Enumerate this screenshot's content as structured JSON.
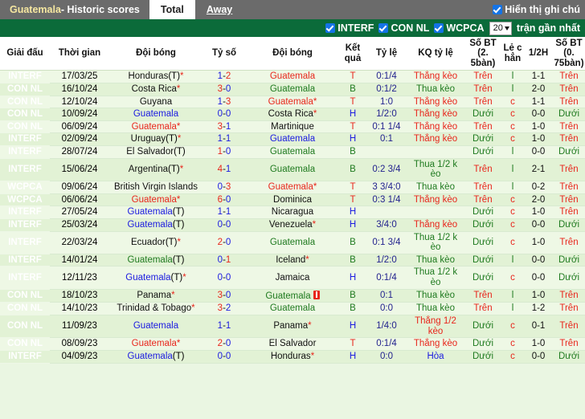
{
  "topbar": {
    "team": "Guatemala",
    "title_rest": " - Historic scores",
    "tab_total": "Total",
    "tab_away": "Away",
    "show_notes_label": "Hiển thị ghi chú",
    "show_notes_checked": true
  },
  "filterbar": {
    "items": [
      {
        "label": "INTERF",
        "checked": true
      },
      {
        "label": "CON NL",
        "checked": true
      },
      {
        "label": "WCPCA",
        "checked": true
      }
    ],
    "count_value": "20",
    "count_suffix": "trận gần nhất"
  },
  "table": {
    "headers": [
      "Giải đấu",
      "Thời gian",
      "Đội bóng",
      "Tỷ số",
      "Đội bóng",
      "Kết quả",
      "Tỷ lệ",
      "KQ tỷ lệ",
      "Số BT (2. 5bàn)",
      "Lẻ c hẳn",
      "1/2H",
      "Số BT (0. 75bàn)"
    ],
    "rows": [
      {
        "league": "INTERF",
        "lg": "INTERF",
        "date": "17/03/25",
        "home": "Honduras(T)",
        "home_star": true,
        "home_color": "black",
        "score_a": "1",
        "score_b": "2",
        "score_a_color": "blue",
        "score_b_color": "red",
        "away": "Guatemala",
        "away_star": false,
        "away_color": "red",
        "result": "T",
        "result_color": "red",
        "odds": "0:1/4",
        "kq": "Thắng kèo",
        "kq_color": "red",
        "bt25": "Trên",
        "bt25_color": "red",
        "oddeven": "l",
        "oddeven_color": "green",
        "half": "1-1",
        "bt075": "Trên",
        "bt075_color": "red",
        "redcard": false
      },
      {
        "league": "CON NL",
        "lg": "CONNL",
        "date": "16/10/24",
        "home": "Costa Rica",
        "home_star": true,
        "home_color": "black",
        "score_a": "3",
        "score_b": "0",
        "score_a_color": "red",
        "score_b_color": "blue",
        "away": "Guatemala",
        "away_star": false,
        "away_color": "green",
        "result": "B",
        "result_color": "green",
        "odds": "0:1/2",
        "kq": "Thua kèo",
        "kq_color": "green",
        "bt25": "Trên",
        "bt25_color": "red",
        "oddeven": "l",
        "oddeven_color": "green",
        "half": "2-0",
        "bt075": "Trên",
        "bt075_color": "red",
        "redcard": false
      },
      {
        "league": "CON NL",
        "lg": "CONNL",
        "date": "12/10/24",
        "home": "Guyana",
        "home_star": false,
        "home_color": "black",
        "score_a": "1",
        "score_b": "3",
        "score_a_color": "blue",
        "score_b_color": "red",
        "away": "Guatemala",
        "away_star": true,
        "away_color": "red",
        "result": "T",
        "result_color": "red",
        "odds": "1:0",
        "kq": "Thắng kèo",
        "kq_color": "red",
        "bt25": "Trên",
        "bt25_color": "red",
        "oddeven": "c",
        "oddeven_color": "red",
        "half": "1-1",
        "bt075": "Trên",
        "bt075_color": "red",
        "redcard": false
      },
      {
        "league": "CON NL",
        "lg": "CONNL",
        "date": "10/09/24",
        "home": "Guatemala",
        "home_star": false,
        "home_color": "blue",
        "score_a": "0",
        "score_b": "0",
        "score_a_color": "blue",
        "score_b_color": "blue",
        "away": "Costa Rica",
        "away_star": true,
        "away_color": "black",
        "result": "H",
        "result_color": "blue",
        "odds": "1/2:0",
        "kq": "Thắng kèo",
        "kq_color": "red",
        "bt25": "Dưới",
        "bt25_color": "green",
        "oddeven": "c",
        "oddeven_color": "red",
        "half": "0-0",
        "bt075": "Dưới",
        "bt075_color": "green",
        "redcard": false
      },
      {
        "league": "CON NL",
        "lg": "CONNL",
        "date": "06/09/24",
        "home": "Guatemala",
        "home_star": true,
        "home_color": "red",
        "score_a": "3",
        "score_b": "1",
        "score_a_color": "red",
        "score_b_color": "blue",
        "away": "Martinique",
        "away_star": false,
        "away_color": "black",
        "result": "T",
        "result_color": "red",
        "odds": "0:1 1/4",
        "kq": "Thắng kèo",
        "kq_color": "red",
        "bt25": "Trên",
        "bt25_color": "red",
        "oddeven": "c",
        "oddeven_color": "red",
        "half": "1-0",
        "bt075": "Trên",
        "bt075_color": "red",
        "redcard": false
      },
      {
        "league": "INTERF",
        "lg": "INTERF",
        "date": "02/09/24",
        "home": "Uruguay(T)",
        "home_star": true,
        "home_color": "black",
        "score_a": "1",
        "score_b": "1",
        "score_a_color": "blue",
        "score_b_color": "blue",
        "away": "Guatemala",
        "away_star": false,
        "away_color": "blue",
        "result": "H",
        "result_color": "blue",
        "odds": "0:1",
        "kq": "Thắng kèo",
        "kq_color": "red",
        "bt25": "Dưới",
        "bt25_color": "green",
        "oddeven": "c",
        "oddeven_color": "red",
        "half": "1-0",
        "bt075": "Trên",
        "bt075_color": "red",
        "redcard": false
      },
      {
        "league": "INTERF",
        "lg": "INTERF",
        "date": "28/07/24",
        "home": "El Salvador(T)",
        "home_star": false,
        "home_color": "black",
        "score_a": "1",
        "score_b": "0",
        "score_a_color": "red",
        "score_b_color": "blue",
        "away": "Guatemala",
        "away_star": false,
        "away_color": "green",
        "result": "B",
        "result_color": "green",
        "odds": "",
        "kq": "",
        "kq_color": "black",
        "bt25": "Dưới",
        "bt25_color": "green",
        "oddeven": "l",
        "oddeven_color": "green",
        "half": "0-0",
        "bt075": "Dưới",
        "bt075_color": "green",
        "redcard": false
      },
      {
        "league": "INTERF",
        "lg": "INTERF",
        "date": "15/06/24",
        "home": "Argentina(T)",
        "home_star": true,
        "home_color": "black",
        "score_a": "4",
        "score_b": "1",
        "score_a_color": "red",
        "score_b_color": "blue",
        "away": "Guatemala",
        "away_star": false,
        "away_color": "green",
        "result": "B",
        "result_color": "green",
        "odds": "0:2 3/4",
        "kq": "Thua 1/2 k èo",
        "kq_color": "green",
        "bt25": "Trên",
        "bt25_color": "red",
        "oddeven": "l",
        "oddeven_color": "green",
        "half": "2-1",
        "bt075": "Trên",
        "bt075_color": "red",
        "redcard": false
      },
      {
        "league": "WCPCA",
        "lg": "WCPCA",
        "date": "09/06/24",
        "home": "British Virgin Islands",
        "home_star": false,
        "home_color": "black",
        "score_a": "0",
        "score_b": "3",
        "score_a_color": "blue",
        "score_b_color": "red",
        "away": "Guatemala",
        "away_star": true,
        "away_color": "red",
        "result": "T",
        "result_color": "red",
        "odds": "3 3/4:0",
        "kq": "Thua kèo",
        "kq_color": "green",
        "bt25": "Trên",
        "bt25_color": "red",
        "oddeven": "l",
        "oddeven_color": "green",
        "half": "0-2",
        "bt075": "Trên",
        "bt075_color": "red",
        "redcard": false
      },
      {
        "league": "WCPCA",
        "lg": "WCPCA",
        "date": "06/06/24",
        "home": "Guatemala",
        "home_star": true,
        "home_color": "red",
        "score_a": "6",
        "score_b": "0",
        "score_a_color": "red",
        "score_b_color": "blue",
        "away": "Dominica",
        "away_star": false,
        "away_color": "black",
        "result": "T",
        "result_color": "red",
        "odds": "0:3 1/4",
        "kq": "Thắng kèo",
        "kq_color": "red",
        "bt25": "Trên",
        "bt25_color": "red",
        "oddeven": "c",
        "oddeven_color": "red",
        "half": "2-0",
        "bt075": "Trên",
        "bt075_color": "red",
        "redcard": false
      },
      {
        "league": "INTERF",
        "lg": "INTERF",
        "date": "27/05/24",
        "home": "Guatemala(T)",
        "home_star": false,
        "home_color": "blue",
        "score_a": "1",
        "score_b": "1",
        "score_a_color": "blue",
        "score_b_color": "blue",
        "away": "Nicaragua",
        "away_star": false,
        "away_color": "black",
        "result": "H",
        "result_color": "blue",
        "odds": "",
        "kq": "",
        "kq_color": "black",
        "bt25": "Dưới",
        "bt25_color": "green",
        "oddeven": "c",
        "oddeven_color": "red",
        "half": "1-0",
        "bt075": "Trên",
        "bt075_color": "red",
        "redcard": false
      },
      {
        "league": "INTERF",
        "lg": "INTERF",
        "date": "25/03/24",
        "home": "Guatemala(T)",
        "home_star": false,
        "home_color": "blue",
        "score_a": "0",
        "score_b": "0",
        "score_a_color": "blue",
        "score_b_color": "blue",
        "away": "Venezuela",
        "away_star": true,
        "away_color": "black",
        "result": "H",
        "result_color": "blue",
        "odds": "3/4:0",
        "kq": "Thắng kèo",
        "kq_color": "red",
        "bt25": "Dưới",
        "bt25_color": "green",
        "oddeven": "c",
        "oddeven_color": "red",
        "half": "0-0",
        "bt075": "Dưới",
        "bt075_color": "green",
        "redcard": false
      },
      {
        "league": "INTERF",
        "lg": "INTERF",
        "date": "22/03/24",
        "home": "Ecuador(T)",
        "home_star": true,
        "home_color": "black",
        "score_a": "2",
        "score_b": "0",
        "score_a_color": "red",
        "score_b_color": "blue",
        "away": "Guatemala",
        "away_star": false,
        "away_color": "green",
        "result": "B",
        "result_color": "green",
        "odds": "0:1 3/4",
        "kq": "Thua 1/2 k èo",
        "kq_color": "green",
        "bt25": "Dưới",
        "bt25_color": "green",
        "oddeven": "c",
        "oddeven_color": "red",
        "half": "1-0",
        "bt075": "Trên",
        "bt075_color": "red",
        "redcard": false
      },
      {
        "league": "INTERF",
        "lg": "INTERF",
        "date": "14/01/24",
        "home": "Guatemala(T)",
        "home_star": false,
        "home_color": "green",
        "score_a": "0",
        "score_b": "1",
        "score_a_color": "blue",
        "score_b_color": "red",
        "away": "Iceland",
        "away_star": true,
        "away_color": "black",
        "result": "B",
        "result_color": "green",
        "odds": "1/2:0",
        "kq": "Thua kèo",
        "kq_color": "green",
        "bt25": "Dưới",
        "bt25_color": "green",
        "oddeven": "l",
        "oddeven_color": "green",
        "half": "0-0",
        "bt075": "Dưới",
        "bt075_color": "green",
        "redcard": false
      },
      {
        "league": "INTERF",
        "lg": "INTERF",
        "date": "12/11/23",
        "home": "Guatemala(T)",
        "home_star": true,
        "home_color": "blue",
        "score_a": "0",
        "score_b": "0",
        "score_a_color": "blue",
        "score_b_color": "blue",
        "away": "Jamaica",
        "away_star": false,
        "away_color": "black",
        "result": "H",
        "result_color": "blue",
        "odds": "0:1/4",
        "kq": "Thua 1/2 k èo",
        "kq_color": "green",
        "bt25": "Dưới",
        "bt25_color": "green",
        "oddeven": "c",
        "oddeven_color": "red",
        "half": "0-0",
        "bt075": "Dưới",
        "bt075_color": "green",
        "redcard": false
      },
      {
        "league": "CON NL",
        "lg": "CONNL",
        "date": "18/10/23",
        "home": "Panama",
        "home_star": true,
        "home_color": "black",
        "score_a": "3",
        "score_b": "0",
        "score_a_color": "red",
        "score_b_color": "blue",
        "away": "Guatemala",
        "away_star": false,
        "away_color": "green",
        "result": "B",
        "result_color": "green",
        "odds": "0:1",
        "kq": "Thua kèo",
        "kq_color": "green",
        "bt25": "Trên",
        "bt25_color": "red",
        "oddeven": "l",
        "oddeven_color": "green",
        "half": "1-0",
        "bt075": "Trên",
        "bt075_color": "red",
        "redcard": true
      },
      {
        "league": "CON NL",
        "lg": "CONNL",
        "date": "14/10/23",
        "home": "Trinidad & Tobago",
        "home_star": true,
        "home_color": "black",
        "score_a": "3",
        "score_b": "2",
        "score_a_color": "red",
        "score_b_color": "blue",
        "away": "Guatemala",
        "away_star": false,
        "away_color": "green",
        "result": "B",
        "result_color": "green",
        "odds": "0:0",
        "kq": "Thua kèo",
        "kq_color": "green",
        "bt25": "Trên",
        "bt25_color": "red",
        "oddeven": "l",
        "oddeven_color": "green",
        "half": "1-2",
        "bt075": "Trên",
        "bt075_color": "red",
        "redcard": false
      },
      {
        "league": "CON NL",
        "lg": "CONNL",
        "date": "11/09/23",
        "home": "Guatemala",
        "home_star": false,
        "home_color": "blue",
        "score_a": "1",
        "score_b": "1",
        "score_a_color": "blue",
        "score_b_color": "blue",
        "away": "Panama",
        "away_star": true,
        "away_color": "black",
        "result": "H",
        "result_color": "blue",
        "odds": "1/4:0",
        "kq": "Thắng 1/2 kèo",
        "kq_color": "red",
        "bt25": "Dưới",
        "bt25_color": "green",
        "oddeven": "c",
        "oddeven_color": "red",
        "half": "0-1",
        "bt075": "Trên",
        "bt075_color": "red",
        "redcard": false
      },
      {
        "league": "CON NL",
        "lg": "CONNL",
        "date": "08/09/23",
        "home": "Guatemala",
        "home_star": true,
        "home_color": "red",
        "score_a": "2",
        "score_b": "0",
        "score_a_color": "red",
        "score_b_color": "blue",
        "away": "El Salvador",
        "away_star": false,
        "away_color": "black",
        "result": "T",
        "result_color": "red",
        "odds": "0:1/4",
        "kq": "Thắng kèo",
        "kq_color": "red",
        "bt25": "Dưới",
        "bt25_color": "green",
        "oddeven": "c",
        "oddeven_color": "red",
        "half": "1-0",
        "bt075": "Trên",
        "bt075_color": "red",
        "redcard": false
      },
      {
        "league": "INTERF",
        "lg": "INTERF",
        "date": "04/09/23",
        "home": "Guatemala(T)",
        "home_star": false,
        "home_color": "blue",
        "score_a": "0",
        "score_b": "0",
        "score_a_color": "blue",
        "score_b_color": "blue",
        "away": "Honduras",
        "away_star": true,
        "away_color": "black",
        "result": "H",
        "result_color": "blue",
        "odds": "0:0",
        "kq": "Hòa",
        "kq_color": "blue",
        "bt25": "Dưới",
        "bt25_color": "green",
        "oddeven": "c",
        "oddeven_color": "red",
        "half": "0-0",
        "bt075": "Dưới",
        "bt075_color": "green",
        "redcard": false
      }
    ]
  }
}
